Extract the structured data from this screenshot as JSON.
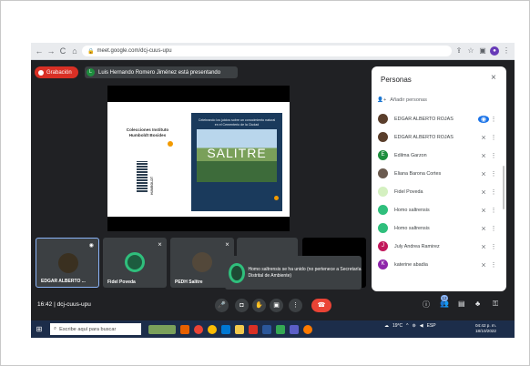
{
  "browser": {
    "url": "meet.google.com/dcj-cuus-upu",
    "nav": {
      "back": "←",
      "forward": "→",
      "reload": "C",
      "home": "⌂"
    }
  },
  "meet": {
    "recording_label": "Grabación",
    "presenter_initial": "L",
    "presenter_banner": "Luis Hernando Romero Jiménez está presentando",
    "meeting_code": "dcj-cuus-upu",
    "time": "16:42",
    "separator": "|"
  },
  "slide": {
    "title": "Colecciones Instituto Humboldt Bosides",
    "panel_text": "Celebrando los juicios sobre un conocimiento natural en el Cementerio de la Ciudad",
    "word": "SALITRE",
    "side_text": "HUMBOLDT"
  },
  "people": {
    "title": "Personas",
    "close": "×",
    "add_label": "Añadir personas",
    "list": [
      {
        "name": "EDGAR ALBERTO ROJAS",
        "color": "#5a3e2b",
        "initial": "",
        "status": "speaking"
      },
      {
        "name": "EDGAR ALBERTO ROJAS",
        "color": "#5a3e2b",
        "initial": "",
        "status": "muted"
      },
      {
        "name": "Edilma Garzon",
        "color": "#1e8e3e",
        "initial": "E",
        "status": "muted"
      },
      {
        "name": "Eliana Barona Cortes",
        "color": "#6b5b4f",
        "initial": "",
        "status": "muted"
      },
      {
        "name": "Fidel Poveda",
        "color": "#d4f0c0",
        "initial": "",
        "status": "muted"
      },
      {
        "name": "Homo saltrensis",
        "color": "#2fbf7c",
        "initial": "",
        "status": "muted"
      },
      {
        "name": "Homo saltrensis",
        "color": "#2fbf7c",
        "initial": "",
        "status": "muted"
      },
      {
        "name": "July Andrea Ramirez",
        "color": "#c2185b",
        "initial": "J",
        "status": "muted"
      },
      {
        "name": "katerine abadia",
        "color": "#8e24aa",
        "initial": "K",
        "status": "muted"
      }
    ]
  },
  "tiles": [
    {
      "name": "EDGAR ALBERTO ..."
    },
    {
      "name": "Fidel Poveda"
    },
    {
      "name": "PEDH Salitre"
    }
  ],
  "toast": {
    "text": "Homo saltrensis se ha unido (no pertenece a Secretaría Distrital de Ambiente)"
  },
  "controls": {
    "participant_count": "12"
  },
  "taskbar": {
    "search_placeholder": "Escribe aquí para buscar",
    "weather": "19°C",
    "lang": "ESP",
    "time": "04:42 p. m.",
    "date": "18/10/2022"
  },
  "colors": {
    "meet_bg": "#202124",
    "tile_bg": "#3c4043",
    "recording_red": "#d93025",
    "hangup_red": "#ea4335",
    "accent_green": "#2fbf7c"
  }
}
